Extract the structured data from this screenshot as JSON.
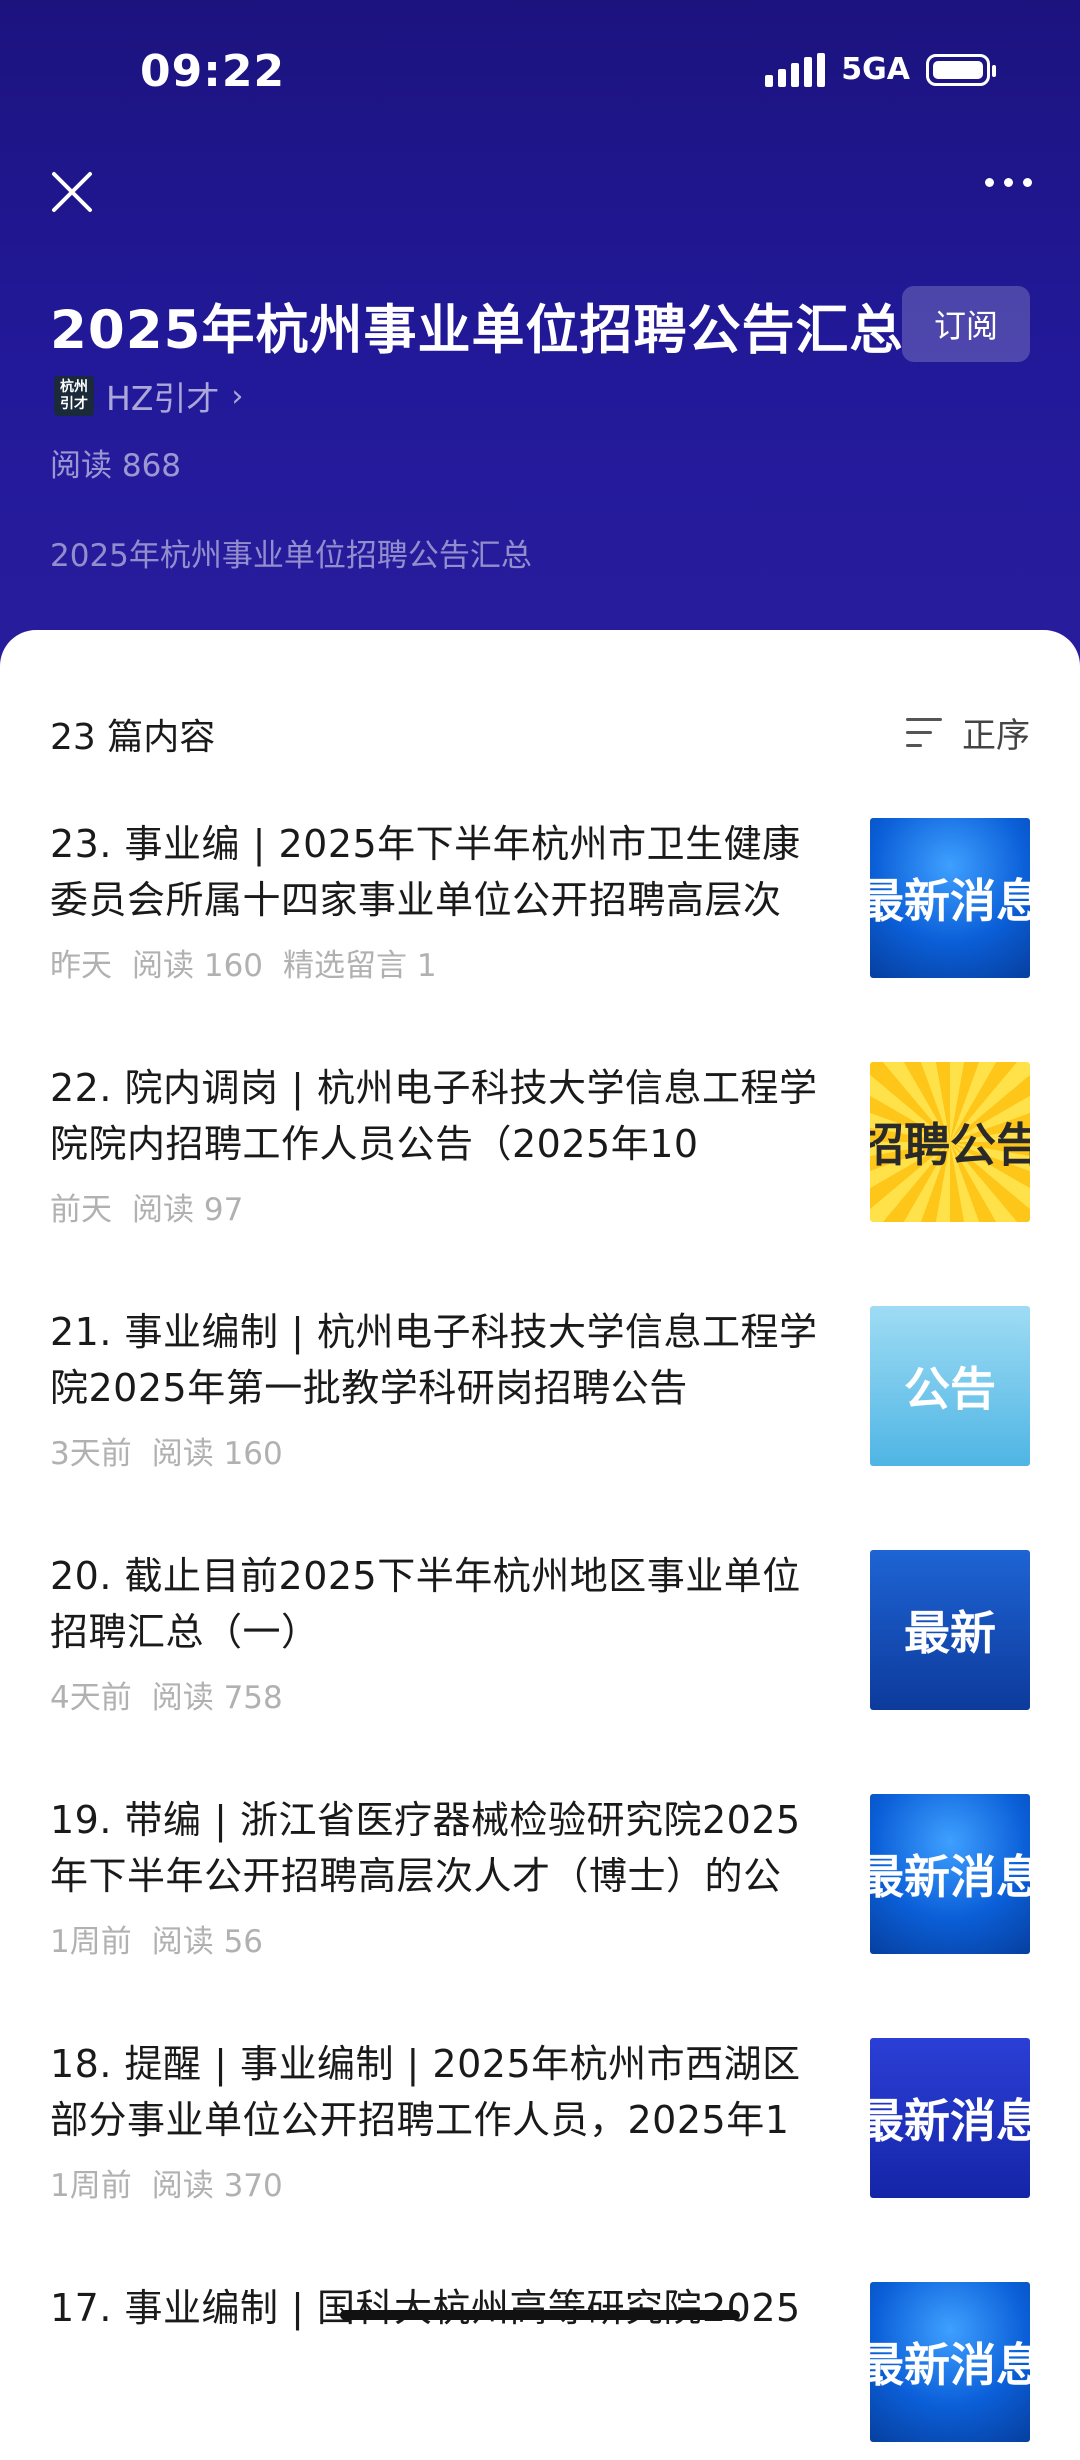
{
  "status": {
    "time": "09:22",
    "network": "5GA"
  },
  "header": {
    "title": "2025年杭州事业单位招聘公告汇总",
    "subscribe_label": "订阅",
    "author_logo_line1": "杭州",
    "author_logo_line2": "引才",
    "author_name": "HZ引才",
    "reads": "阅读 868",
    "description": "2025年杭州事业单位招聘公告汇总"
  },
  "list": {
    "count_label": "23 篇内容",
    "sort_label": "正序",
    "items": [
      {
        "title": "23. 事业编 | 2025年下半年杭州市卫生健康委员会所属十四家事业单位公开招聘高层次",
        "time": "昨天",
        "reads": "阅读 160",
        "extra": "精选留言 1",
        "thumb_text": "最新消息"
      },
      {
        "title": "22. 院内调岗 | 杭州电子科技大学信息工程学院院内招聘工作人员公告（2025年10",
        "time": "前天",
        "reads": "阅读 97",
        "extra": "",
        "thumb_text": "招聘公告"
      },
      {
        "title": "21. 事业编制 | 杭州电子科技大学信息工程学院2025年第一批教学科研岗招聘公告",
        "time": "3天前",
        "reads": "阅读 160",
        "extra": "",
        "thumb_text": "公告"
      },
      {
        "title": "20. 截止目前2025下半年杭州地区事业单位招聘汇总（一）",
        "time": "4天前",
        "reads": "阅读 758",
        "extra": "",
        "thumb_text": "最新"
      },
      {
        "title": "19. 带编 | 浙江省医疗器械检验研究院2025年下半年公开招聘高层次人才（博士）的公",
        "time": "1周前",
        "reads": "阅读 56",
        "extra": "",
        "thumb_text": "最新消息"
      },
      {
        "title": "18. 提醒 | 事业编制 | 2025年杭州市西湖区部分事业单位公开招聘工作人员，2025年1",
        "time": "1周前",
        "reads": "阅读 370",
        "extra": "",
        "thumb_text": "最新消息"
      },
      {
        "title": "17. 事业编制 | 国科大杭州高等研究院2025",
        "time": "",
        "reads": "",
        "extra": "",
        "thumb_text": "最新消息"
      }
    ]
  }
}
